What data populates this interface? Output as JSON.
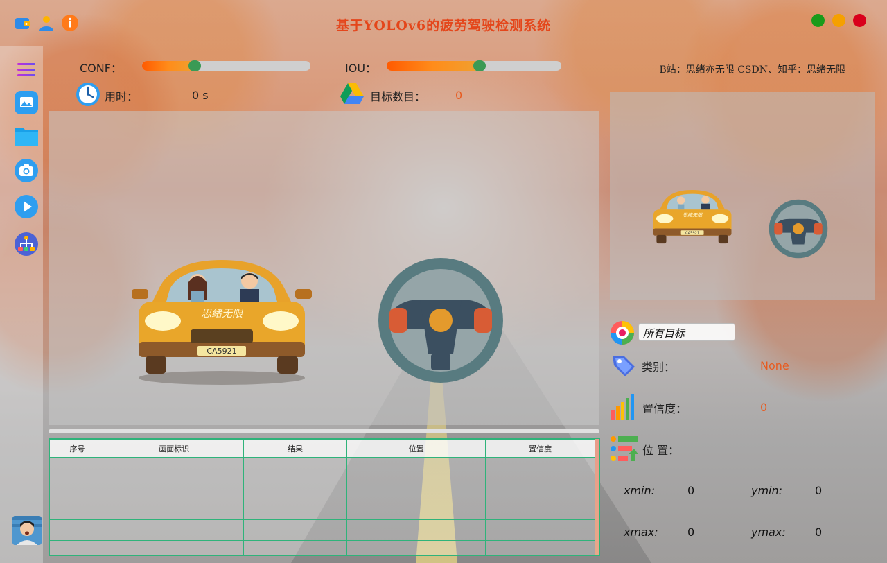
{
  "title": "基于YOLOv6的疲劳驾驶检测系统",
  "window_buttons": {
    "close_color": "#d9001b",
    "min_color": "#f5a000",
    "max_color": "#1a9b1a"
  },
  "controls": {
    "conf_label": "CONF：",
    "conf_level_percent": 28,
    "iou_label": "IOU：",
    "iou_level_percent": 50
  },
  "stats": {
    "time_label": "用时：",
    "time_value": "0 s",
    "count_label": "目标数目：",
    "count_value": "0"
  },
  "credit": "B站：思绪亦无限  CSDN、知乎：思绪无限",
  "main_scene": {
    "car_plate": "CA5921",
    "car_text": "思绪无限"
  },
  "preview_scene": {
    "car_plate": "CA5921",
    "car_text": "思绪无限"
  },
  "table": {
    "headers": [
      "序号",
      "画面标识",
      "结果",
      "位置",
      "置信度"
    ],
    "rows": [
      [
        "",
        "",
        "",
        "",
        ""
      ],
      [
        "",
        "",
        "",
        "",
        ""
      ],
      [
        "",
        "",
        "",
        "",
        ""
      ],
      [
        "",
        "",
        "",
        "",
        ""
      ],
      [
        "",
        "",
        "",
        "",
        ""
      ]
    ]
  },
  "detail": {
    "target_select": "所有目标",
    "class_label": "类别：",
    "class_value": "None",
    "confidence_label": "置信度：",
    "confidence_value": "0",
    "position_label": "位 置：",
    "xmin_label": "xmin:",
    "xmin_value": "0",
    "ymin_label": "ymin:",
    "ymin_value": "0",
    "xmax_label": "xmax:",
    "xmax_value": "0",
    "ymax_label": "ymax:",
    "ymax_value": "0"
  },
  "icons": {
    "sidebar": [
      "menu-icon",
      "image-icon",
      "folder-icon",
      "camera-icon",
      "play-icon",
      "model-tree-icon"
    ],
    "top": [
      "wallet-icon",
      "user-icon",
      "info-icon"
    ]
  }
}
